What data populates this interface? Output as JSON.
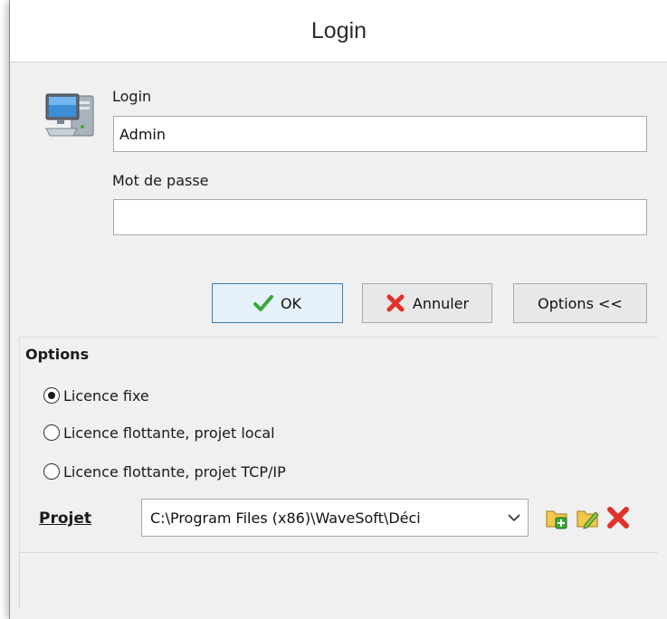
{
  "window": {
    "title": "Login"
  },
  "login": {
    "login_label": "Login",
    "login_value": "Admin",
    "password_label": "Mot de passe",
    "password_value": ""
  },
  "buttons": {
    "ok_label": "OK",
    "cancel_label": "Annuler",
    "options_label": "Options <<"
  },
  "options": {
    "heading": "Options",
    "radios": [
      {
        "label": "Licence fixe",
        "checked": true
      },
      {
        "label": "Licence flottante, projet local",
        "checked": false
      },
      {
        "label": "Licence flottante, projet TCP/IP",
        "checked": false
      }
    ],
    "projet_label": "Projet",
    "projet_value": "C:\\Program Files (x86)\\WaveSoft\\Déci"
  },
  "icons": {
    "computer": "computer-icon",
    "ok": "checkmark-icon",
    "cancel": "red-x-icon",
    "dropdown": "chevron-down-icon",
    "add_project": "folder-add-icon",
    "edit_project": "folder-edit-icon",
    "delete_project": "red-x-icon"
  },
  "colors": {
    "ok_green": "#3aa83a",
    "cancel_red": "#e0322b",
    "primary_border": "#3c7fb1"
  }
}
